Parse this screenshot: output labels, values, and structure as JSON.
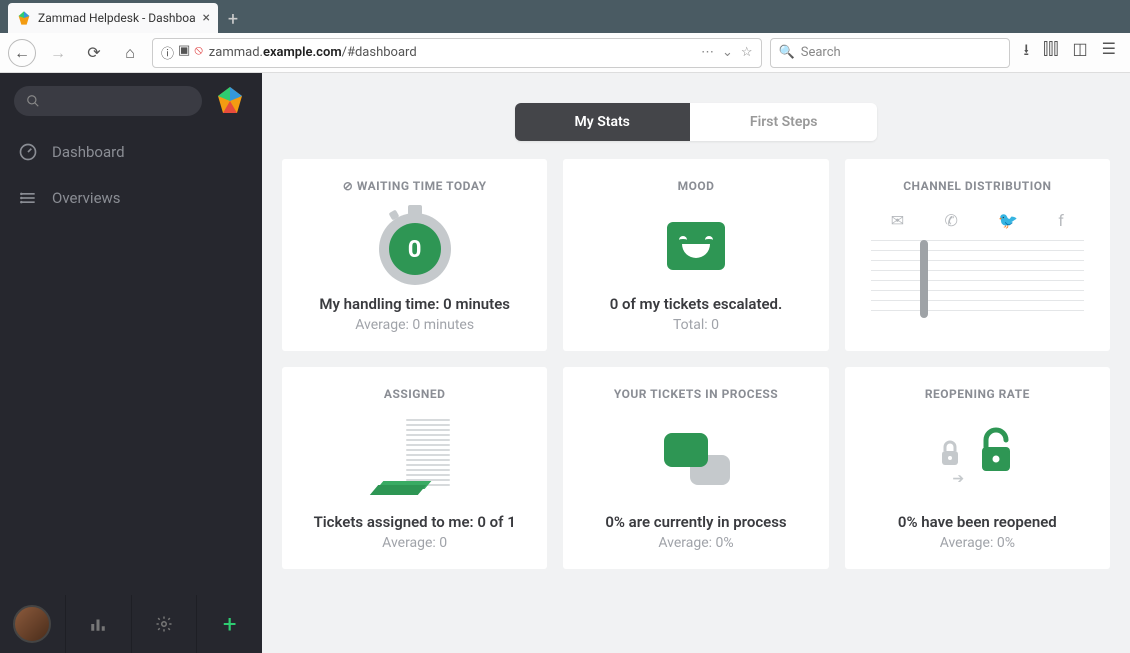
{
  "browser": {
    "tab_title": "Zammad Helpdesk - Dashboa",
    "url_prefix": "zammad.",
    "url_host": "example.com",
    "url_path": "/#dashboard",
    "search_placeholder": "Search"
  },
  "sidebar": {
    "items": [
      {
        "label": "Dashboard"
      },
      {
        "label": "Overviews"
      }
    ]
  },
  "tabs": {
    "active": "My Stats",
    "inactive": "First Steps"
  },
  "cards": {
    "waiting": {
      "title": "⊘ WAITING TIME TODAY",
      "value": "0",
      "line1": "My handling time: 0 minutes",
      "line2": "Average: 0 minutes"
    },
    "mood": {
      "title": "MOOD",
      "line1": "0 of my tickets escalated.",
      "line2": "Total: 0"
    },
    "channel": {
      "title": "CHANNEL DISTRIBUTION"
    },
    "assigned": {
      "title": "ASSIGNED",
      "line1": "Tickets assigned to me: 0 of 1",
      "line2": "Average: 0"
    },
    "process": {
      "title": "YOUR TICKETS IN PROCESS",
      "line1": "0% are currently in process",
      "line2": "Average: 0%"
    },
    "reopening": {
      "title": "REOPENING RATE",
      "line1": "0% have been reopened",
      "line2": "Average: 0%"
    }
  }
}
